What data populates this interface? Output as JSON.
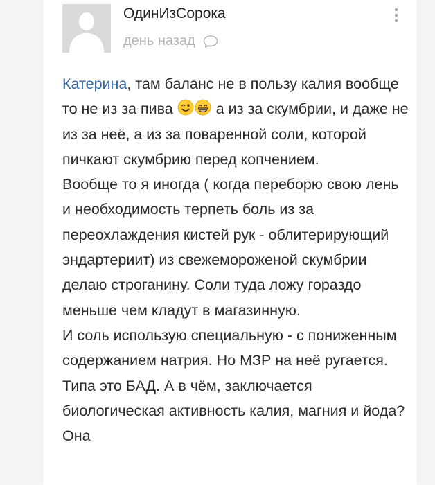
{
  "comment": {
    "author": "ОдинИзСорока",
    "timestamp": "день назад",
    "mention": "Катерина",
    "paragraph1": {
      "after_mention": ", там баланс не в пользу калия вообще то не из за пива",
      "emojis": [
        "winking-face",
        "grinning-face"
      ],
      "after_emojis": " а из за скумбрии, и даже не из за неё, а из за поваренной соли, которой пичкают скумбрию перед копчением."
    },
    "paragraph2": "Вообще то я иногда ( когда переборю свою лень и необходимость терпеть боль из за переохлаждения кистей рук - облитерирующий эндартериит) из свежемороженой скумбрии делаю строганину. Соли туда ложу гораздо меньше чем кладут в магазинную.",
    "paragraph3": "И соль использую специальную - с пониженным содержанием натрия. Но МЗР на неё ругается. Типа это БАД. А в чём, заключается биологическая активность калия, магния и йода? Она"
  },
  "colors": {
    "mention": "#3366a6",
    "text": "#2a2a2a",
    "muted": "#b5b5b5",
    "avatar_bg": "#d9d9d9"
  },
  "icons": {
    "reply": "speech-bubble-icon",
    "more": "vertical-dots-icon",
    "avatar": "default-user-silhouette"
  }
}
